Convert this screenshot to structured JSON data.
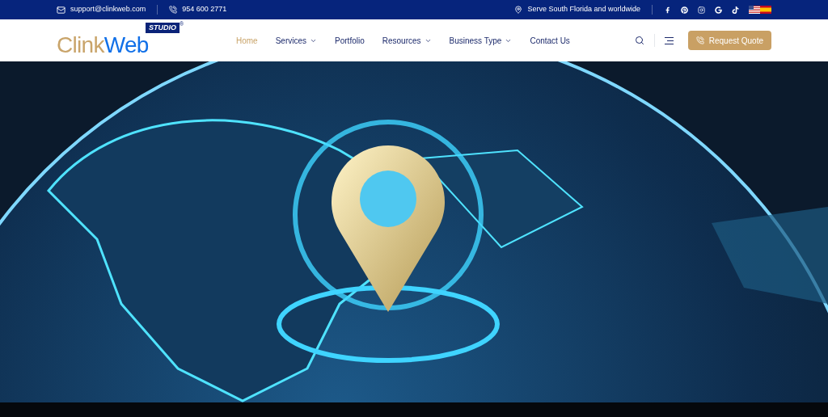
{
  "top_bar": {
    "email": "support@clinkweb.com",
    "phone": "954 600 2771",
    "location": "Serve South Florida and worldwide"
  },
  "logo": {
    "part_1": "Clink",
    "part_2": "Web",
    "badge": "STUDIO",
    "mark": "®"
  },
  "nav": [
    {
      "label": "Home",
      "selected": true,
      "has_dropdown": false
    },
    {
      "label": "Services",
      "selected": false,
      "has_dropdown": true
    },
    {
      "label": "Portfolio",
      "selected": false,
      "has_dropdown": false
    },
    {
      "label": "Resources",
      "selected": false,
      "has_dropdown": true
    },
    {
      "label": "Business Type",
      "selected": false,
      "has_dropdown": true
    },
    {
      "label": "Contact Us",
      "selected": false,
      "has_dropdown": false
    }
  ],
  "cta": {
    "label": "Request Quote"
  }
}
